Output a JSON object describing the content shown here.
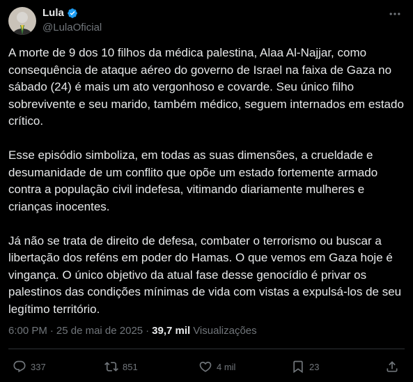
{
  "author": {
    "name": "Lula",
    "handle": "@LulaOficial",
    "verified": true
  },
  "post": {
    "paragraphs": [
      "A morte de 9 dos 10 filhos da médica palestina, Alaa Al-Najjar, como consequência de ataque aéreo do governo de Israel na faixa de Gaza no sábado (24) é mais um ato vergonhoso e covarde. Seu único filho sobrevivente e seu marido, também médico, seguem internados em estado crítico.",
      "Esse episódio simboliza, em todas as suas dimensões, a crueldade e desumanidade de um conflito que opõe um estado fortemente armado contra a população civil indefesa, vitimando diariamente mulheres e crianças inocentes.",
      "Já não se trata de direito de defesa, combater o terrorismo ou buscar a libertação dos reféns em poder do Hamas. O que vemos em Gaza hoje é vingança. O único objetivo da atual fase desse genocídio é privar os palestinos das condições mínimas de vida com vistas a expulsá-los de seu legítimo território."
    ],
    "time": "6:00 PM",
    "separator": "·",
    "date": "25 de mai de 2025",
    "views_count": "39,7 mil",
    "views_label": "Visualizações"
  },
  "actions": {
    "replies": "337",
    "reposts": "851",
    "likes": "4 mil",
    "bookmarks": "23"
  },
  "icons": {
    "verified": "verified-badge-icon",
    "more": "more-options-icon",
    "reply": "reply-icon",
    "repost": "repost-icon",
    "like": "heart-icon",
    "bookmark": "bookmark-icon",
    "share": "share-icon"
  },
  "colors": {
    "background": "#000000",
    "text": "#e7e9ea",
    "secondary": "#71767b",
    "verified": "#1d9bf0",
    "divider": "#2f3336"
  }
}
